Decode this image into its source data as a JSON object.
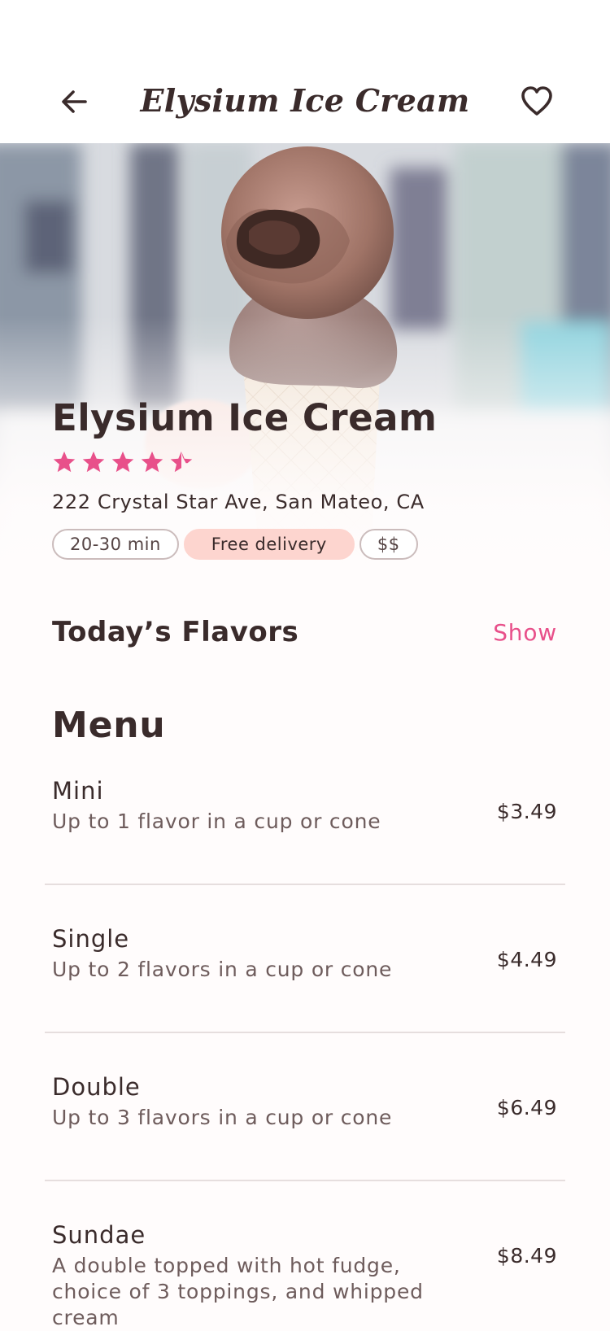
{
  "app_bar": {
    "title": "Elysium Ice Cream",
    "back_icon": "arrow-left-icon",
    "favorite_icon": "heart-outline-icon"
  },
  "store": {
    "name": "Elysium Ice Cream",
    "rating": 4.5,
    "rating_max": 5,
    "address": "222 Crystal Star Ave, San Mateo, CA",
    "chips": [
      "20-30 min",
      "Free delivery",
      "$$"
    ]
  },
  "flavors": {
    "title": "Today’s Flavors",
    "action_label": "Show"
  },
  "menu": {
    "title": "Menu",
    "items": [
      {
        "name": "Mini",
        "description": "Up to 1 flavor in a cup or cone",
        "price": "$3.49"
      },
      {
        "name": "Single",
        "description": "Up to 2 flavors in a cup or cone",
        "price": "$4.49"
      },
      {
        "name": "Double",
        "description": "Up to 3 flavors in a cup or cone",
        "price": "$6.49"
      },
      {
        "name": "Sundae",
        "description": "A double topped with hot fudge, choice of 3 toppings, and whipped cream",
        "price": "$8.49"
      }
    ]
  },
  "colors": {
    "accent": "#e8508a",
    "chip_fill": "#fdd5cf",
    "text": "#3a2b2b",
    "background": "#fffcfc"
  }
}
